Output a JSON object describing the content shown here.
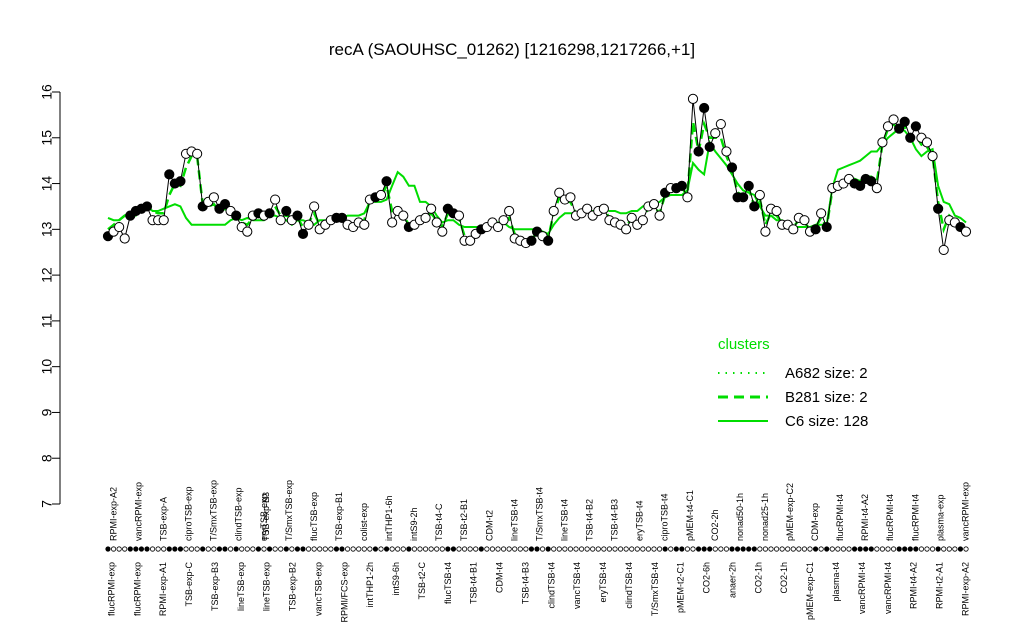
{
  "chart_data": {
    "type": "line",
    "title": "recA (SAOUHSC_01262) [1216298,1217266,+1]",
    "xlabel": "",
    "ylabel": "",
    "ylim": [
      7,
      16
    ],
    "yticks": [
      7,
      8,
      9,
      10,
      11,
      12,
      13,
      14,
      15,
      16
    ],
    "grid": false,
    "legend": {
      "position": "right",
      "title": "clusters",
      "entries": [
        {
          "label": "A682 size: 2",
          "style": "dotted"
        },
        {
          "label": "B281 size: 2",
          "style": "dashed"
        },
        {
          "label": "C6 size: 128",
          "style": "solid"
        }
      ]
    },
    "line_color": "#00dd00",
    "categories_top": [
      "RPMI-exp-A2",
      "vancRPMI-exp",
      "TSB-exp-A",
      "ciproTSB-exp",
      "T/SmxTSB-exp",
      "clindTSB-exp",
      "eryTSB-exp",
      "T/SmxTSB-exp",
      "flucTSB-exp",
      "TSB-exp-B1",
      "colist-exp",
      "intTHP1-6h",
      "intS9-2h",
      "TSB-t4-C",
      "TSB-t2-B1",
      "CDM-t2",
      "lineTSB-t4",
      "T/SmxTSB-t4",
      "lineTSB-t4",
      "TSB-t4-B2",
      "TSB-t4-B3",
      "eryTSB-t4",
      "ciproTSB-t4",
      "pMEM-t4-C1",
      "CO2-2h",
      "nonad50-1h",
      "nonad25-1h",
      "pMEM-exp-C2",
      "CDM-exp",
      "flucRPMI-t4",
      "RPMI-t4-A2",
      "flucRPMI-t4",
      "flucRPMI-t4",
      "plasma-exp",
      "vancRPMI-exp"
    ],
    "categories_bottom": [
      "flucRPMI-exp",
      "flucRPMI-exp",
      "RPMI-exp-A1",
      "TSB-exp-C",
      "TSB-exp-B3",
      "lineTSB-exp",
      "lineTSB-exp",
      "TSB-exp-B2",
      "vancTSB-exp",
      "RPMI/FCS-exp",
      "intTHP1-2h",
      "intS9-6h",
      "TSB-t2-C",
      "flucTSB-t4",
      "TSB-t4-B1",
      "CDM-t4",
      "TSB-t4-B3",
      "clindTSB-t4",
      "vancTSB-t4",
      "eryTSB-t4",
      "clindTSB-t4",
      "T/SmxTSB-t4",
      "pMEM-t2-C1",
      "CO2-6h",
      "anaer-2h",
      "CO2-1h",
      "CO2-1h",
      "pMEM-exp-C1",
      "plasma-t4",
      "vancRPMI-t4",
      "vancRPMI-t4",
      "RPMI-t4-A2",
      "RPMI-t2-A1",
      "RPMI-exp-A2"
    ],
    "categories_overlap": [
      "TSB-exp-B3"
    ],
    "series": [
      {
        "values": [
          12.85,
          12.95,
          13.05,
          12.8,
          13.3,
          13.4,
          13.45,
          13.5,
          13.2,
          13.2,
          13.2,
          14.2,
          14.0,
          14.05,
          14.65,
          14.7,
          14.65,
          13.5,
          13.6,
          13.7,
          13.45,
          13.55,
          13.4,
          13.3,
          13.05,
          12.95,
          13.3,
          13.35,
          13.3,
          13.35,
          13.65,
          13.2,
          13.4,
          13.2,
          13.3,
          12.9,
          13.1,
          13.5,
          13.0,
          13.1,
          13.2,
          13.25,
          13.25,
          13.1,
          13.05,
          13.15,
          13.1,
          13.65,
          13.7,
          13.75,
          14.05,
          13.15,
          13.4,
          13.3,
          13.05,
          13.1,
          13.2,
          13.25,
          13.45,
          13.15,
          12.95,
          13.45,
          13.35,
          13.3,
          12.75,
          12.75,
          12.9,
          13.0,
          13.05,
          13.15,
          13.05,
          13.2,
          13.4,
          12.8,
          12.75,
          12.7,
          12.75,
          12.95,
          12.85,
          12.75,
          13.4,
          13.8,
          13.65,
          13.7,
          13.3,
          13.35,
          13.45,
          13.3,
          13.4,
          13.45,
          13.2,
          13.15,
          13.1,
          13.0,
          13.25,
          13.1,
          13.2,
          13.5,
          13.55,
          13.3,
          13.8,
          13.9,
          13.9,
          13.95,
          13.7,
          15.85,
          14.7,
          15.65,
          14.8,
          15.1,
          15.3,
          14.7,
          14.35,
          13.7,
          13.7,
          13.95,
          13.5,
          13.75,
          12.95,
          13.45,
          13.4,
          13.1,
          13.1,
          13.0,
          13.25,
          13.2,
          12.95,
          13.0,
          13.35,
          13.05,
          13.9,
          13.95,
          14.0,
          14.1,
          14.0,
          13.95,
          14.1,
          14.05,
          13.9,
          14.9,
          15.25,
          15.4,
          15.2,
          15.35,
          15.0,
          15.25,
          15.0,
          14.9,
          14.6,
          13.45,
          12.55,
          13.2,
          13.15,
          13.05,
          12.95
        ],
        "filled": [
          true,
          false,
          false,
          false,
          true,
          true,
          true,
          true,
          false,
          false,
          false,
          true,
          true,
          true,
          false,
          false,
          false,
          true,
          false,
          false,
          true,
          true,
          false,
          true,
          false,
          false,
          false,
          true,
          false,
          true,
          false,
          false,
          true,
          false,
          true,
          true,
          false,
          false,
          false,
          false,
          false,
          true,
          true,
          false,
          false,
          false,
          false,
          false,
          true,
          false,
          true,
          false,
          false,
          false,
          true,
          false,
          false,
          false,
          false,
          false,
          false,
          true,
          true,
          false,
          false,
          false,
          false,
          true,
          false,
          false,
          false,
          false,
          false,
          false,
          false,
          false,
          true,
          true,
          false,
          true,
          false,
          false,
          false,
          false,
          false,
          false,
          false,
          false,
          false,
          false,
          false,
          false,
          false,
          false,
          false,
          false,
          false,
          false,
          false,
          false,
          true,
          false,
          true,
          true,
          false,
          false,
          true,
          true,
          true,
          false,
          false,
          false,
          true,
          true,
          true,
          true,
          true,
          false,
          false,
          false,
          false,
          false,
          false,
          false,
          false,
          false,
          false,
          true,
          false,
          true,
          false,
          false,
          false,
          false,
          true,
          true,
          true,
          true,
          false,
          false,
          false,
          false,
          true,
          true,
          true,
          true,
          false,
          false,
          false,
          true,
          false,
          false,
          false,
          true,
          false
        ]
      }
    ],
    "cluster_line": [
      13.25,
      13.2,
      13.2,
      13.3,
      13.3,
      13.3,
      13.45,
      13.5,
      13.4,
      13.4,
      13.45,
      13.5,
      13.55,
      13.5,
      13.25,
      13.1,
      13.1,
      13.1,
      13.1,
      13.1,
      13.1,
      13.1,
      13.2,
      13.25,
      13.2,
      13.25,
      13.2,
      13.2,
      13.2,
      13.3,
      13.3,
      13.25,
      13.2,
      13.1,
      13.2,
      13.2,
      13.15,
      13.1,
      13.2,
      13.2,
      13.2,
      13.2,
      13.25,
      13.3,
      13.3,
      13.3,
      13.35,
      13.6,
      13.6,
      13.6,
      13.65,
      13.95,
      14.25,
      14.15,
      13.95,
      13.95,
      13.6,
      13.6,
      13.5,
      13.3,
      13.15,
      13.2,
      13.2,
      13.1,
      13.05,
      13.05,
      13.05,
      13.05,
      13.1,
      13.1,
      13.15,
      13.15,
      13.05,
      13.0,
      13.0,
      13.0,
      13.0,
      13.0,
      12.95,
      12.9,
      13.1,
      13.25,
      13.35,
      13.35,
      13.35,
      13.4,
      13.4,
      13.4,
      13.4,
      13.45,
      13.4,
      13.4,
      13.35,
      13.35,
      13.4,
      13.4,
      13.5,
      13.55,
      13.55,
      13.6,
      13.7,
      13.75,
      13.75,
      13.75,
      13.85,
      14.45,
      14.3,
      14.2,
      14.9,
      14.7,
      14.55,
      14.4,
      14.2,
      14.0,
      13.85,
      13.8,
      13.75,
      13.5,
      13.3,
      13.3,
      13.2,
      13.2,
      13.1,
      13.05,
      13.05,
      13.05,
      13.05,
      13.1,
      13.1,
      13.1,
      13.9,
      14.3,
      14.35,
      14.4,
      14.45,
      14.5,
      14.6,
      14.7,
      14.7,
      14.85,
      15.0,
      15.1,
      15.2,
      15.15,
      15.0,
      14.75,
      14.6,
      14.7,
      14.75,
      13.95,
      13.6,
      13.55,
      13.3,
      13.25,
      13.15
    ],
    "cluster_b281": [
      13.0,
      13.1,
      13.2,
      13.3,
      13.35,
      13.4,
      13.45,
      13.5,
      13.4,
      13.35,
      13.35,
      13.75,
      14.0,
      13.95,
      14.35,
      14.6,
      14.6,
      13.55,
      13.5,
      13.55,
      13.4,
      13.45,
      13.35,
      13.3,
      13.15,
      13.1,
      13.25,
      13.3,
      13.3,
      13.3,
      13.5,
      13.3,
      13.3,
      13.25,
      13.25,
      13.05,
      13.15,
      13.35,
      13.1,
      13.15,
      13.2,
      13.25,
      13.25,
      13.15,
      13.1,
      13.15,
      13.2,
      13.65,
      13.65,
      13.7,
      13.95,
      13.4,
      13.45,
      13.3,
      13.1,
      13.15,
      13.2,
      13.25,
      13.35,
      13.2,
      13.05,
      13.35,
      13.3,
      13.25,
      12.85,
      12.8,
      12.95,
      13.0,
      13.05,
      13.1,
      13.1,
      13.15,
      13.25,
      12.9,
      12.8,
      12.75,
      12.8,
      12.9,
      12.85,
      12.8,
      13.35,
      13.7,
      13.6,
      13.6,
      13.35,
      13.35,
      13.45,
      13.35,
      13.4,
      13.45,
      13.25,
      13.2,
      13.15,
      13.05,
      13.25,
      13.15,
      13.25,
      13.45,
      13.5,
      13.35,
      13.75,
      13.85,
      13.85,
      13.9,
      13.75,
      15.35,
      14.7,
      15.3,
      15.0,
      15.0,
      15.0,
      14.6,
      14.3,
      13.8,
      13.75,
      13.9,
      13.5,
      13.65,
      13.1,
      13.35,
      13.3,
      13.15,
      13.1,
      13.05,
      13.2,
      13.15,
      13.0,
      13.05,
      13.25,
      13.05,
      13.85,
      14.0,
      14.05,
      14.15,
      14.1,
      14.05,
      14.15,
      14.15,
      14.05,
      14.85,
      15.2,
      15.3,
      15.15,
      15.25,
      15.0,
      15.05,
      14.85,
      14.8,
      14.6,
      13.6,
      13.0,
      13.3,
      13.2,
      13.1,
      13.0
    ]
  }
}
